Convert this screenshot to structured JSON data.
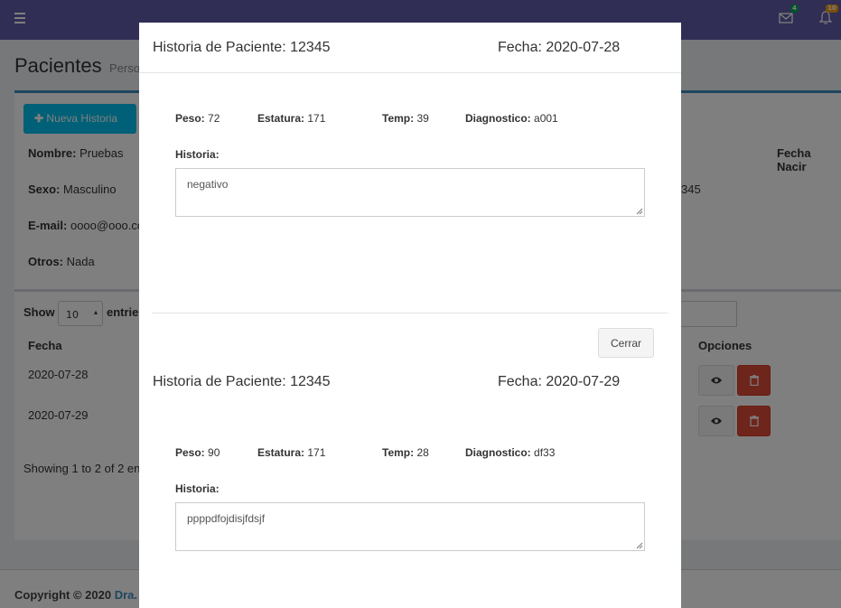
{
  "navbar": {
    "mail_badge": "4",
    "bell_badge": "10",
    "colors": {
      "bar": "#605ca8",
      "mail_badge": "#00a65a",
      "bell_badge": "#f39c12"
    }
  },
  "page": {
    "title": "Pacientes",
    "subtitle": "Perso",
    "new_button": "Nueva Historia",
    "fields": [
      {
        "label": "Nombre:",
        "value": "Pruebas"
      },
      {
        "label": "Sexo:",
        "value": "Masculino"
      },
      {
        "label": "E-mail:",
        "value": "oooo@ooo.co"
      },
      {
        "label": "Otros:",
        "value": "Nada"
      }
    ],
    "right_label": "Fecha Nacir",
    "right_value": "345"
  },
  "table": {
    "show_label": "Show",
    "entries_label": "entrie",
    "page_size": "10",
    "col_fecha": "Fecha",
    "col_opciones": "Opciones",
    "rows": [
      "2020-07-28",
      "2020-07-29"
    ],
    "showing": "Showing 1 to 2 of 2 ent"
  },
  "footer": {
    "copyright": "Copyright © 2020",
    "link": "Dra."
  },
  "modal": {
    "records": [
      {
        "title": "Historia de Paciente: 12345",
        "date": "Fecha: 2020-07-28",
        "peso_label": "Peso:",
        "peso": "72",
        "estatura_label": "Estatura:",
        "estatura": "171",
        "temp_label": "Temp:",
        "temp": "39",
        "diag_label": "Diagnostico:",
        "diag": "a001",
        "historia_label": "Historia:",
        "historia": "negativo"
      },
      {
        "title": "Historia de Paciente: 12345",
        "date": "Fecha: 2020-07-29",
        "peso_label": "Peso:",
        "peso": "90",
        "estatura_label": "Estatura:",
        "estatura": "171",
        "temp_label": "Temp:",
        "temp": "28",
        "diag_label": "Diagnostico:",
        "diag": "df33",
        "historia_label": "Historia:",
        "historia": "ppppdfojdisjfdsjf"
      }
    ],
    "close_button": "Cerrar"
  }
}
